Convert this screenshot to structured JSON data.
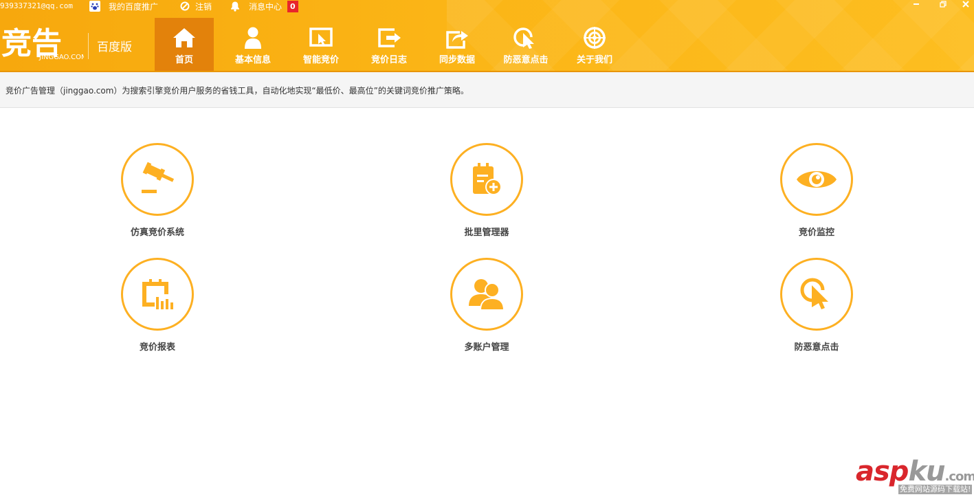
{
  "topbar": {
    "email": "939337321@qq.com",
    "my_promo": "我的百度推广",
    "logout": "注销",
    "messages": "消息中心",
    "message_count": "0"
  },
  "window_controls": {
    "minimize": "–",
    "restore": "▫",
    "close": "✕"
  },
  "logo": {
    "main": "竞告",
    "sub": "JINGGAO.COM"
  },
  "edition": "百度版",
  "nav": [
    {
      "label": "首页",
      "icon": "home-icon",
      "active": true
    },
    {
      "label": "基本信息",
      "icon": "user-icon",
      "active": false
    },
    {
      "label": "智能竞价",
      "icon": "smart-bid-icon",
      "active": false
    },
    {
      "label": "竞价日志",
      "icon": "log-icon",
      "active": false
    },
    {
      "label": "同步数据",
      "icon": "share-icon",
      "active": false
    },
    {
      "label": "防恶意点击",
      "icon": "click-cursor-icon",
      "active": false
    },
    {
      "label": "关于我们",
      "icon": "target-icon",
      "active": false
    }
  ],
  "info": "竞价广告管理（jinggao.com）为搜索引擎竞价用户服务的省钱工具，自动化地实现“最低价、最高位”的关键词竞价推广策略。",
  "features": [
    {
      "label": "仿真竞价系统",
      "icon": "gavel-icon"
    },
    {
      "label": "批里管理器",
      "icon": "clipboard-add-icon"
    },
    {
      "label": "竞价监控",
      "icon": "eye-icon"
    },
    {
      "label": "竞价报表",
      "icon": "report-chart-icon"
    },
    {
      "label": "多账户管理",
      "icon": "users-icon"
    },
    {
      "label": "防恶意点击",
      "icon": "click-cursor-icon"
    }
  ],
  "watermark": {
    "brand_a": "asp",
    "brand_b": "ku",
    "brand_c": ".com",
    "tagline": "免费网站源码下载站!"
  },
  "colors": {
    "accent": "#fdb022",
    "header": "#fbb516",
    "active_tab": "#e3820b",
    "badge": "#e8262b"
  }
}
